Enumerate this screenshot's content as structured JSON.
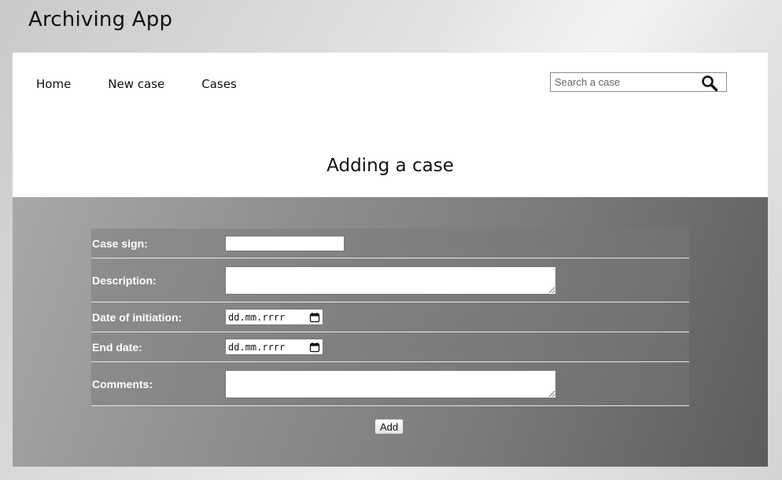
{
  "app": {
    "title": "Archiving App"
  },
  "nav": {
    "items": [
      {
        "label": "Home"
      },
      {
        "label": "New case"
      },
      {
        "label": "Cases"
      }
    ]
  },
  "search": {
    "placeholder": "Search a case",
    "value": "",
    "icon": "magnifier-icon"
  },
  "page": {
    "heading": "Adding a case"
  },
  "form": {
    "fields": [
      {
        "label": "Case sign:",
        "type": "text",
        "value": ""
      },
      {
        "label": "Description:",
        "type": "textarea",
        "value": ""
      },
      {
        "label": "Date of initiation:",
        "type": "date",
        "placeholder": "dd.mm.rrrr"
      },
      {
        "label": "End date:",
        "type": "date",
        "placeholder": "dd.mm.rrrr"
      },
      {
        "label": "Comments:",
        "type": "textarea",
        "value": ""
      }
    ],
    "submit_label": "Add"
  },
  "colors": {
    "panel_bg": "#ffffff",
    "form_bg_start": "#a8a8a8",
    "form_bg_end": "#5c5c5c",
    "label_text": "#ffffff"
  }
}
